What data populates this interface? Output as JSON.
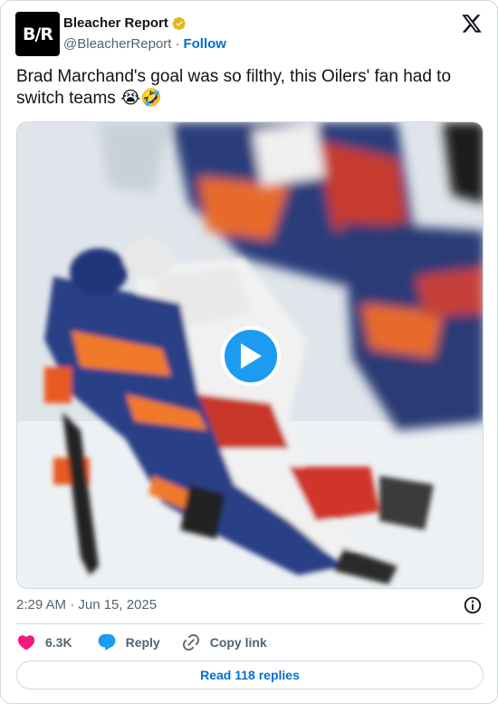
{
  "author": {
    "display_name": "Bleacher Report",
    "handle": "@BleacherReport",
    "avatar_text": "B/R",
    "verified_badge": "gold-check",
    "follow_label": "Follow",
    "separator": "·"
  },
  "tweet": {
    "text": "Brad Marchand's goal was so filthy, this Oilers' fan had to switch teams 😭🤣",
    "timestamp": "2:29 AM · Jun 15, 2025"
  },
  "media": {
    "type": "video",
    "play_icon": "play-icon",
    "description_icon": "video-thumbnail"
  },
  "actions": {
    "like_count": "6.3K",
    "reply_label": "Reply",
    "copy_link_label": "Copy link"
  },
  "footer": {
    "read_replies_label": "Read 118 replies"
  },
  "colors": {
    "accent": "#1d9bf0",
    "link": "#006fd6",
    "like": "#f91880",
    "verified_gold": "#e2b719",
    "muted": "#536471",
    "border": "#cfd9de"
  }
}
